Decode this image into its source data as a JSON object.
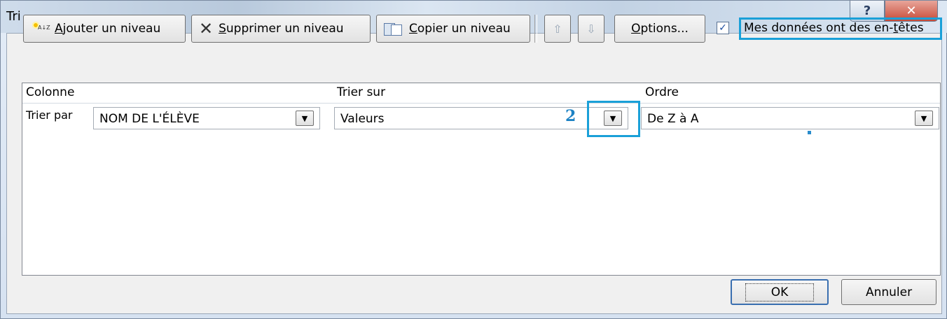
{
  "window": {
    "title": "Tri",
    "help_glyph": "?",
    "close_glyph": "✕"
  },
  "toolbar": {
    "add_level": {
      "accel": "A",
      "rest": "jouter un niveau"
    },
    "delete_level": {
      "accel": "S",
      "rest": "upprimer un niveau"
    },
    "copy_level": {
      "accel": "C",
      "rest": "opier un niveau"
    },
    "move_up_glyph": "⇧",
    "move_down_glyph": "⇩",
    "options": {
      "accel": "O",
      "rest": "ptions..."
    },
    "headers_checkbox": {
      "checked": true,
      "check_glyph": "✓",
      "label_pre": "Mes données ont des en-",
      "label_accel": "t",
      "label_post": "êtes"
    }
  },
  "grid": {
    "headers": {
      "column": "Colonne",
      "sort_on": "Trier sur",
      "order": "Ordre"
    },
    "rows": [
      {
        "label": "Trier par",
        "column": "NOM DE L'ÉLÈVE",
        "sort_on": "Valeurs",
        "order": "De Z à A"
      }
    ]
  },
  "annotation": {
    "step": "2",
    "accent_color": "#1aa0d8"
  },
  "footer": {
    "ok": "OK",
    "cancel": "Annuler"
  }
}
